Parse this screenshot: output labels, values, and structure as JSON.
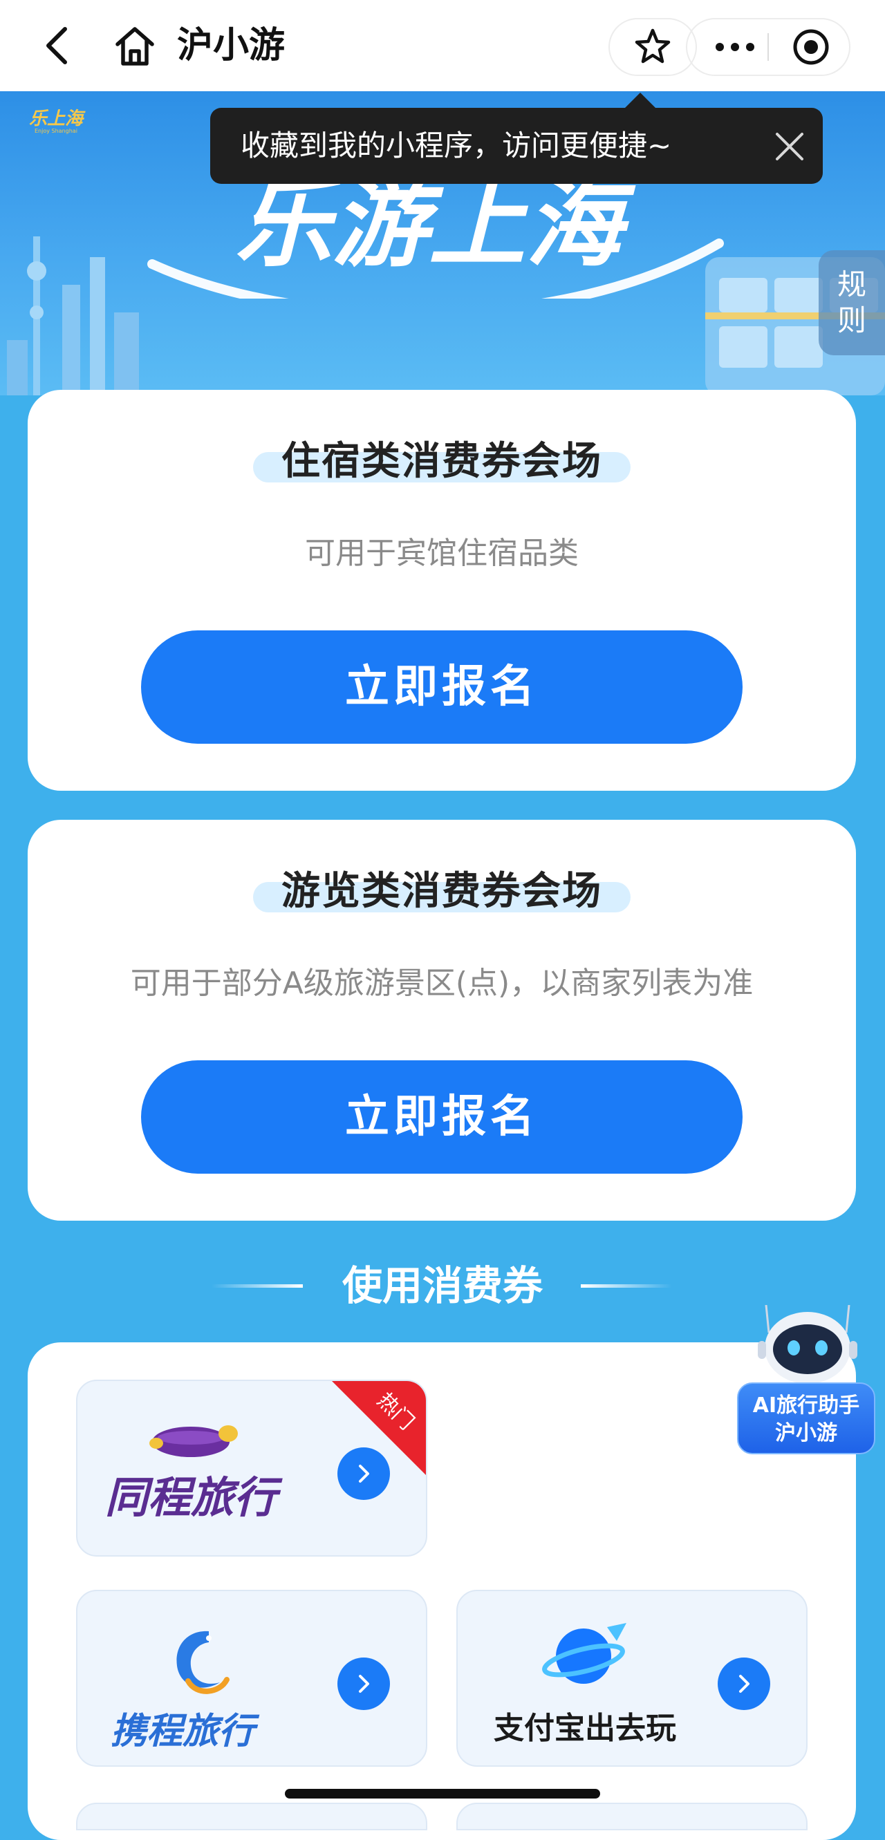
{
  "nav": {
    "title": "沪小游"
  },
  "tooltip": {
    "text": "收藏到我的小程序，访问更便捷~"
  },
  "banner": {
    "title": "乐游上海",
    "rules_line1": "规",
    "rules_line2": "则"
  },
  "cards": [
    {
      "title": "住宿类消费券会场",
      "subtitle": "可用于宾馆住宿品类",
      "button": "立即报名"
    },
    {
      "title": "游览类消费券会场",
      "subtitle": "可用于部分A级旅游景区(点)，以商家列表为准",
      "button": "立即报名"
    }
  ],
  "section": {
    "title": "使用消费券"
  },
  "merchants": [
    {
      "name": "同程旅行",
      "badge": "热门",
      "brand_color": "#5a2d91"
    },
    {
      "name": "携程旅行",
      "badge": "",
      "brand_color": "#2a6fd6"
    },
    {
      "name": "支付宝出去玩",
      "badge": "",
      "brand_color": "#1677ff"
    }
  ],
  "assistant": {
    "line1": "AI旅行助手",
    "line2": "沪小游"
  },
  "colors": {
    "primary_button": "#1b7bf7",
    "page_background": "#3eb0ec",
    "hot_badge": "#e8232c"
  },
  "icons": [
    "back-icon",
    "home-icon",
    "star-icon",
    "more-icon",
    "target-icon",
    "close-icon",
    "chevron-right-icon"
  ]
}
